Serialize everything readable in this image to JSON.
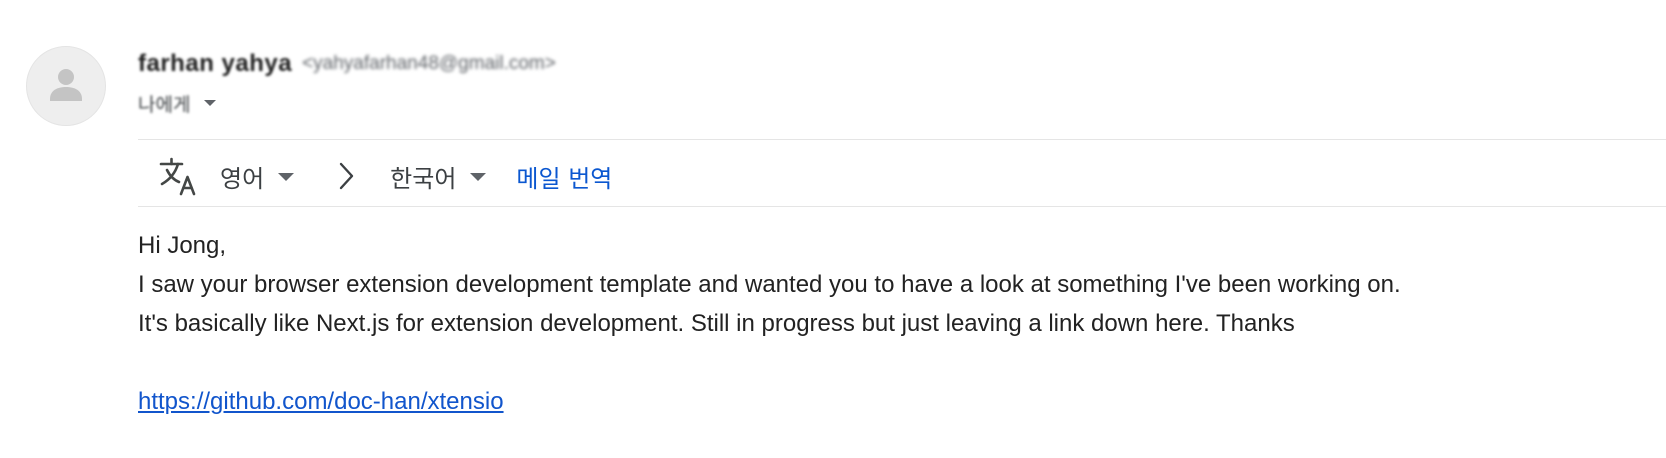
{
  "sender": {
    "name": "farhan yahya",
    "email": "<yahyafarhan48@gmail.com>",
    "avatar_icon": "person-icon"
  },
  "recipient": {
    "label": "나에게"
  },
  "translation": {
    "icon": "translate-icon",
    "source_language": "영어",
    "target_language": "한국어",
    "translate_label": "메일 번역"
  },
  "message": {
    "greeting": "Hi Jong,",
    "line1": "I saw your browser extension development template and wanted you to have a look at something I've been working on.",
    "line2": "It's basically like Next.js for extension development. Still in progress but just leaving a link down here. Thanks",
    "link_text": "https://github.com/doc-han/xtensio",
    "link_href": "https://github.com/doc-han/xtensio"
  },
  "colors": {
    "link": "#1155cc",
    "translate_link": "#0b57d0",
    "divider": "#e5e5e5"
  }
}
